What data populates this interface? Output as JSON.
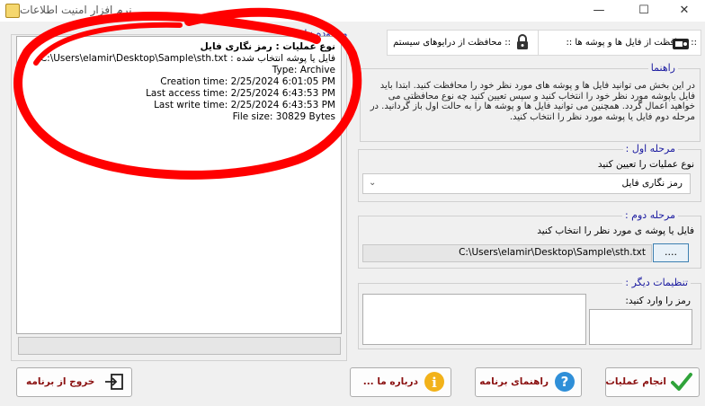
{
  "window": {
    "title": "نرم افزار امنیت اطلاعات",
    "minimize": "—",
    "maximize": "☐",
    "close": "✕"
  },
  "results": {
    "legend": "محدوده نتایج :",
    "lines": [
      "نوع عملیات : رمز نگاری فایل",
      "فایل یا پوشه انتخاب شده : C:\\Users\\elamir\\Desktop\\Sample\\sth.txt",
      "Type: Archive",
      "Creation time: 2/25/2024 6:01:05 PM",
      "Last access time: 2/25/2024 6:43:53 PM",
      "Last write time: 2/25/2024 6:43:53 PM",
      "File size: 30829 Bytes"
    ]
  },
  "tabs": {
    "files": ":: محافظت از فایل ها و پوشه ها ::",
    "drives": ":: محافظت از درایوهای سیستم"
  },
  "help": {
    "legend": "راهنما",
    "text": "در این بخش می توانید فایل ها و پوشه های مورد نظر خود را محافظت کنید. ابتدا باید فایل یاپوشه مورد نظر خود را انتخاب کنید و سپس تعیین کنید چه نوع محافظتی می خواهید اعمال گردد. همچنین می توانید فایل ها و پوشه ها را به حالت اول باز گردانید. در مرحله دوم فایل یا پوشه مورد نظر را انتخاب کنید."
  },
  "step1": {
    "legend": "مرحله اول :",
    "label": "نوع عملیات را تعیین کنید",
    "selected": "رمز نگاری فایل"
  },
  "step2": {
    "legend": "مرحله دوم :",
    "label": "فایل یا پوشه ی مورد نظر را انتخاب کنید",
    "path": "C:\\Users\\elamir\\Desktop\\Sample\\sth.txt",
    "browse": "...."
  },
  "other": {
    "legend": "تنظیمات دیگر :",
    "password_label": "رمز را وارد کنید:"
  },
  "buttons": {
    "execute": "انجام عملیات",
    "help": "راهنمای برنامه",
    "about": "درباره ما ...",
    "exit": "خروج از برنامه"
  },
  "colors": {
    "legend": "#1a1aa0",
    "button_text": "#8a1010",
    "scribble": "#ff0000"
  },
  "icons": {
    "execute": "checkmark-icon",
    "help": "question-icon",
    "about": "info-icon",
    "exit": "exit-icon",
    "files_tab": "vault-icon",
    "drives_tab": "padlock-icon"
  }
}
